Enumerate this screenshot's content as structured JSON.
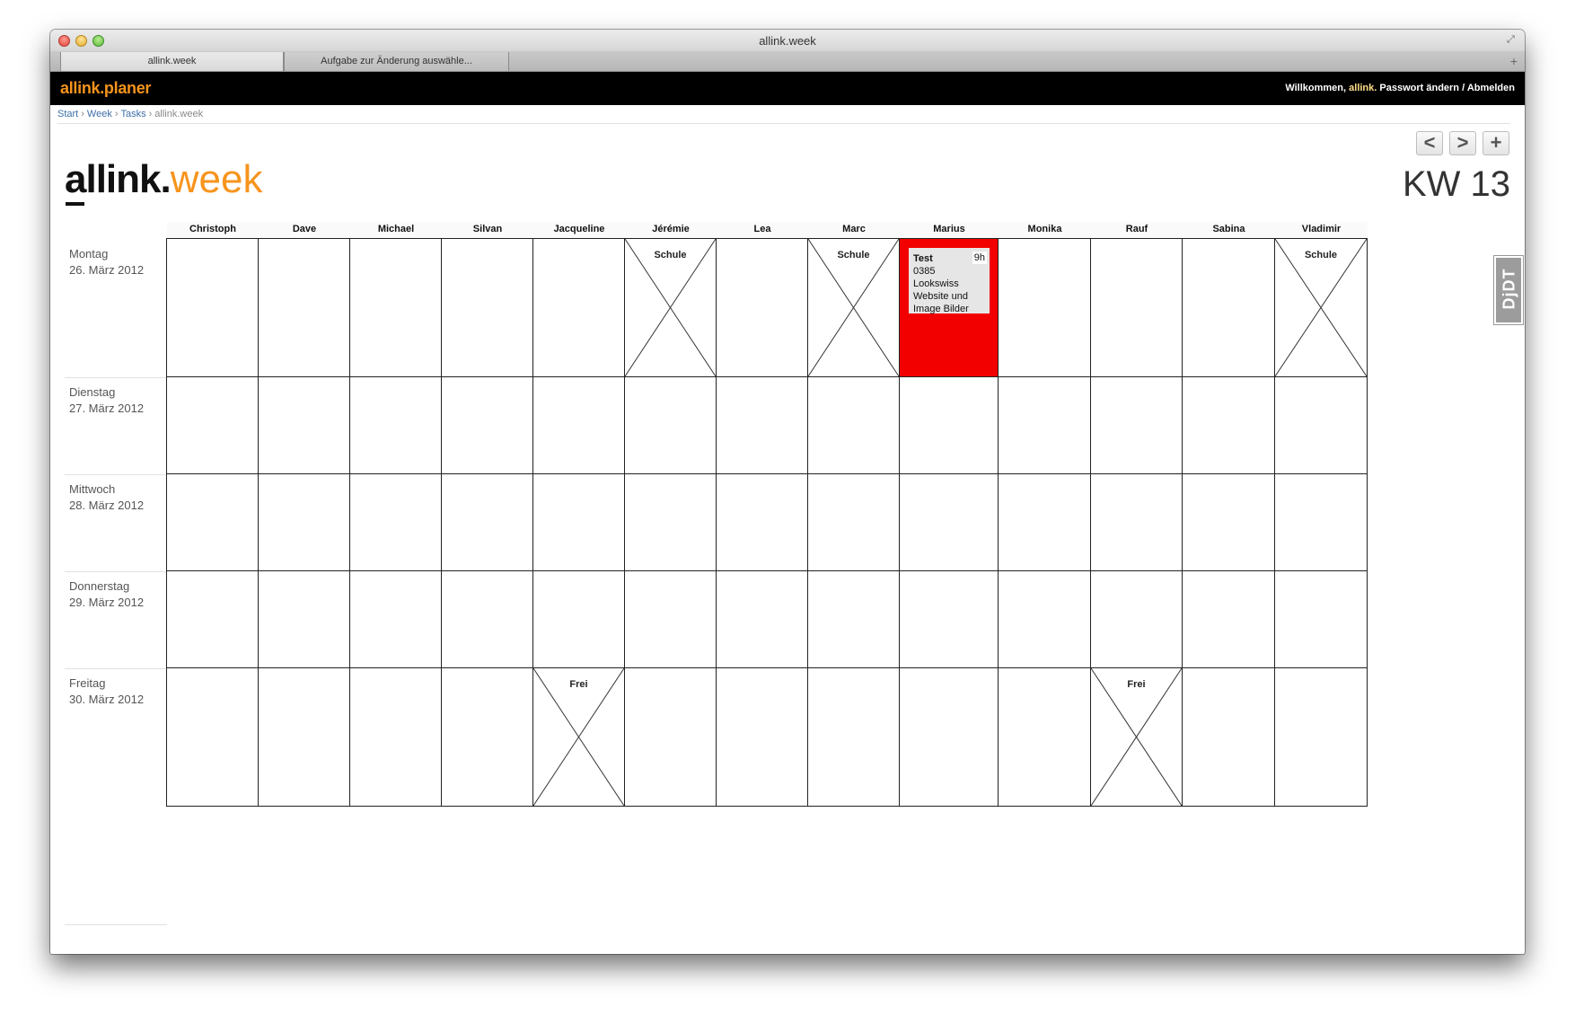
{
  "browser": {
    "window_title": "allink.week",
    "tabs": [
      {
        "label": "allink.week"
      },
      {
        "label": "Aufgabe zur Änderung auswähle..."
      }
    ]
  },
  "app": {
    "brand": "allink.planer",
    "welcome": "Willkommen,",
    "username": "allink.",
    "change_password": "Passwort ändern",
    "separator": "/",
    "logout": "Abmelden"
  },
  "breadcrumb": [
    {
      "label": "Start",
      "link": true
    },
    {
      "label": "Week",
      "link": true
    },
    {
      "label": "Tasks",
      "link": true
    },
    {
      "label": "allink.week",
      "link": false
    }
  ],
  "breadcrumb_sep": "›",
  "nav": {
    "prev": "<",
    "next": ">",
    "add": "+"
  },
  "page": {
    "logo_bold": "allink",
    "logo_dot": ".",
    "logo_light": "week",
    "week": "KW 13"
  },
  "people": [
    "Christoph",
    "Dave",
    "Michael",
    "Silvan",
    "Jacqueline",
    "Jérémie",
    "Lea",
    "Marc",
    "Marius",
    "Monika",
    "Rauf",
    "Sabina",
    "Vladimir"
  ],
  "days": [
    {
      "name": "Montag",
      "date": "26. März 2012"
    },
    {
      "name": "Dienstag",
      "date": "27. März 2012"
    },
    {
      "name": "Mittwoch",
      "date": "28. März 2012"
    },
    {
      "name": "Donnerstag",
      "date": "29. März 2012"
    },
    {
      "name": "Freitag",
      "date": "30. März 2012"
    }
  ],
  "absences": [
    {
      "day": 0,
      "person": 5,
      "label": "Schule"
    },
    {
      "day": 0,
      "person": 7,
      "label": "Schule"
    },
    {
      "day": 0,
      "person": 12,
      "label": "Schule"
    },
    {
      "day": 4,
      "person": 4,
      "label": "Frei"
    },
    {
      "day": 4,
      "person": 10,
      "label": "Frei"
    }
  ],
  "tasks": [
    {
      "day": 0,
      "person": 8,
      "title": "Test",
      "hours": "9h",
      "line1": "0385",
      "line2": "Lookswiss",
      "line3": "Website und",
      "line4": "Image Bilder",
      "color": "#f20000"
    }
  ],
  "debug_toolbar": {
    "label": "DjDT"
  }
}
